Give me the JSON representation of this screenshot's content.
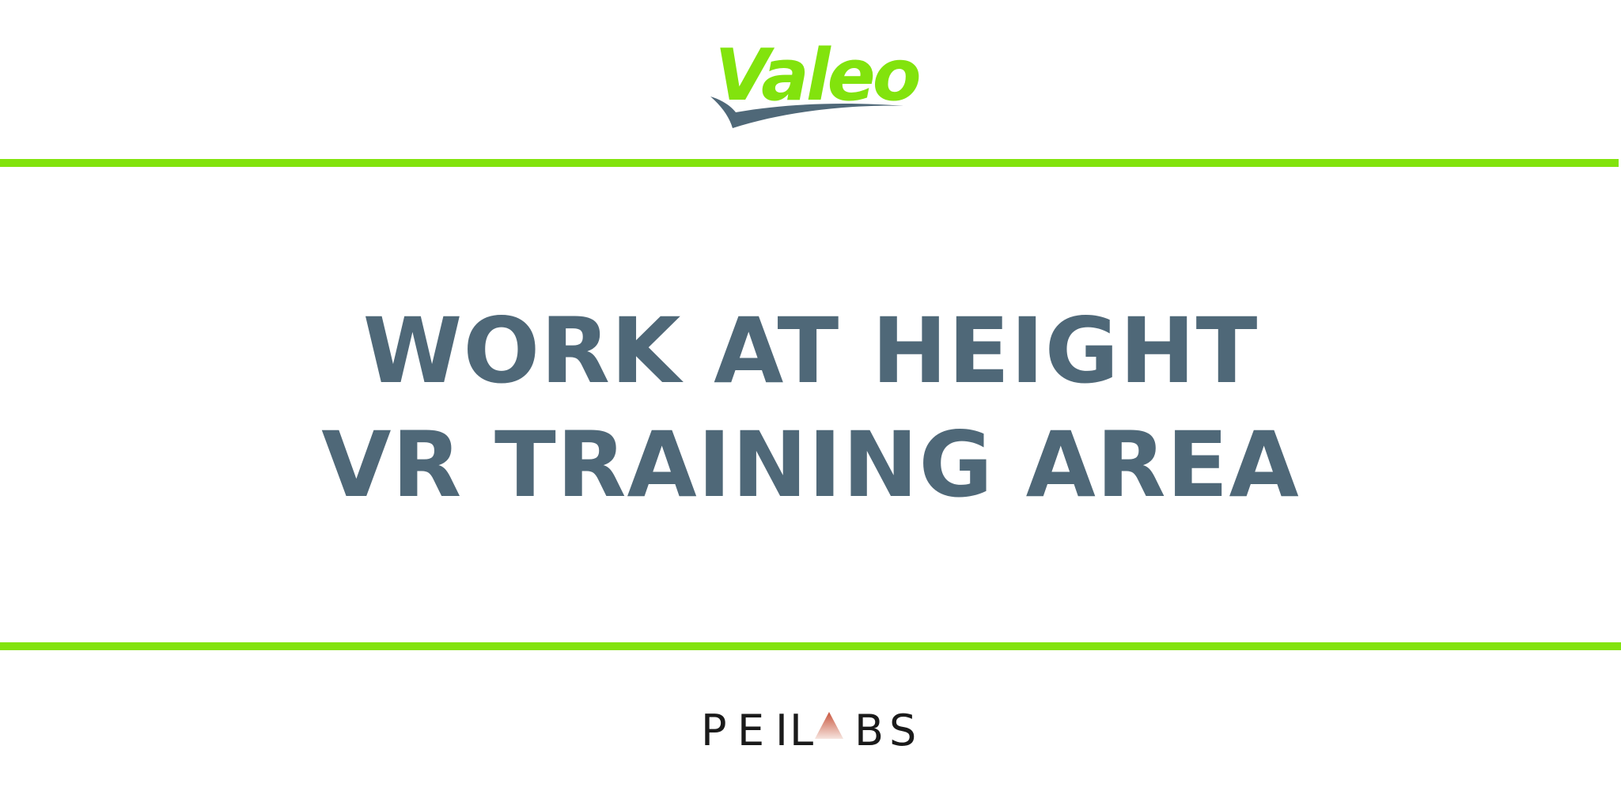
{
  "brand": {
    "top_logo_text": "Valeo",
    "bottom_logo_text": "PEILABS",
    "bottom_logo_letters": [
      "P",
      "E",
      "I",
      "L",
      "B",
      "S"
    ]
  },
  "headline": {
    "line1": "WORK AT HEIGHT",
    "line2": "VR TRAINING AREA"
  },
  "colors": {
    "accent_green": "#82e30d",
    "title_slate": "#4f6878",
    "logo_swoosh": "#4f6878",
    "peilabs_text": "#1a1a1a",
    "peilabs_triangle_top": "#c8543c",
    "peilabs_triangle_bottom": "#f3ddd6"
  }
}
